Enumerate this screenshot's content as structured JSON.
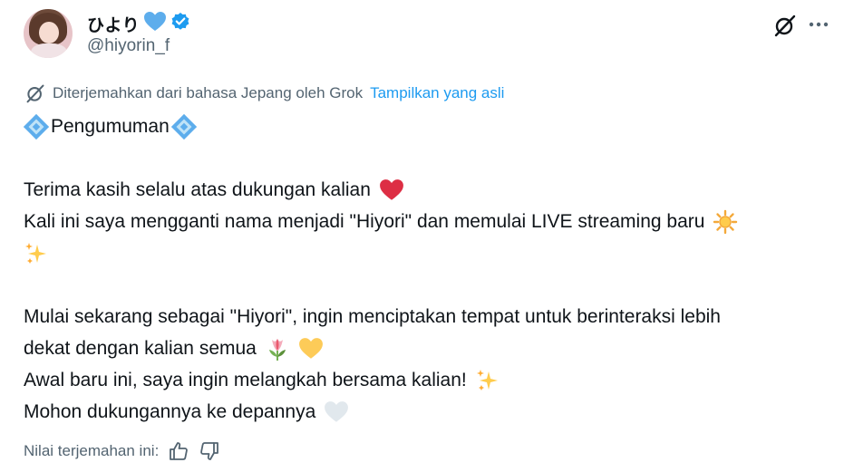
{
  "author": {
    "display_name": "ひより",
    "handle": "@hiyorin_f",
    "verified": true
  },
  "translation": {
    "notice": "Diterjemahkan dari bahasa Jepang oleh Grok",
    "show_original_label": "Tampilkan yang asli"
  },
  "tweet": {
    "heading": "Pengumuman",
    "line1": "Terima kasih selalu atas dukungan kalian",
    "line2": "Kali ini saya mengganti nama menjadi \"Hiyori\" dan memulai LIVE streaming baru",
    "line3": "Mulai sekarang sebagai \"Hiyori\", ingin menciptakan tempat untuk berinteraksi lebih",
    "line4": "dekat dengan kalian semua",
    "line5": "Awal baru ini, saya ingin melangkah bersama kalian!",
    "line6": "Mohon dukungannya ke depannya"
  },
  "rating": {
    "label": "Nilai terjemahan ini:"
  },
  "colors": {
    "link": "#1d9bf0",
    "muted": "#536471",
    "text": "#0f1419",
    "heart_blue": "#5dadec",
    "verified": "#1d9bf0"
  },
  "icons": [
    "grok-icon",
    "more-icon",
    "verified-badge-icon",
    "blue-heart-icon",
    "thumbs-up-icon",
    "thumbs-down-icon",
    "diamond-icon",
    "red-heart-icon",
    "sun-icon",
    "sparkles-icon",
    "tulip-icon",
    "yellow-heart-icon",
    "white-heart-icon"
  ]
}
